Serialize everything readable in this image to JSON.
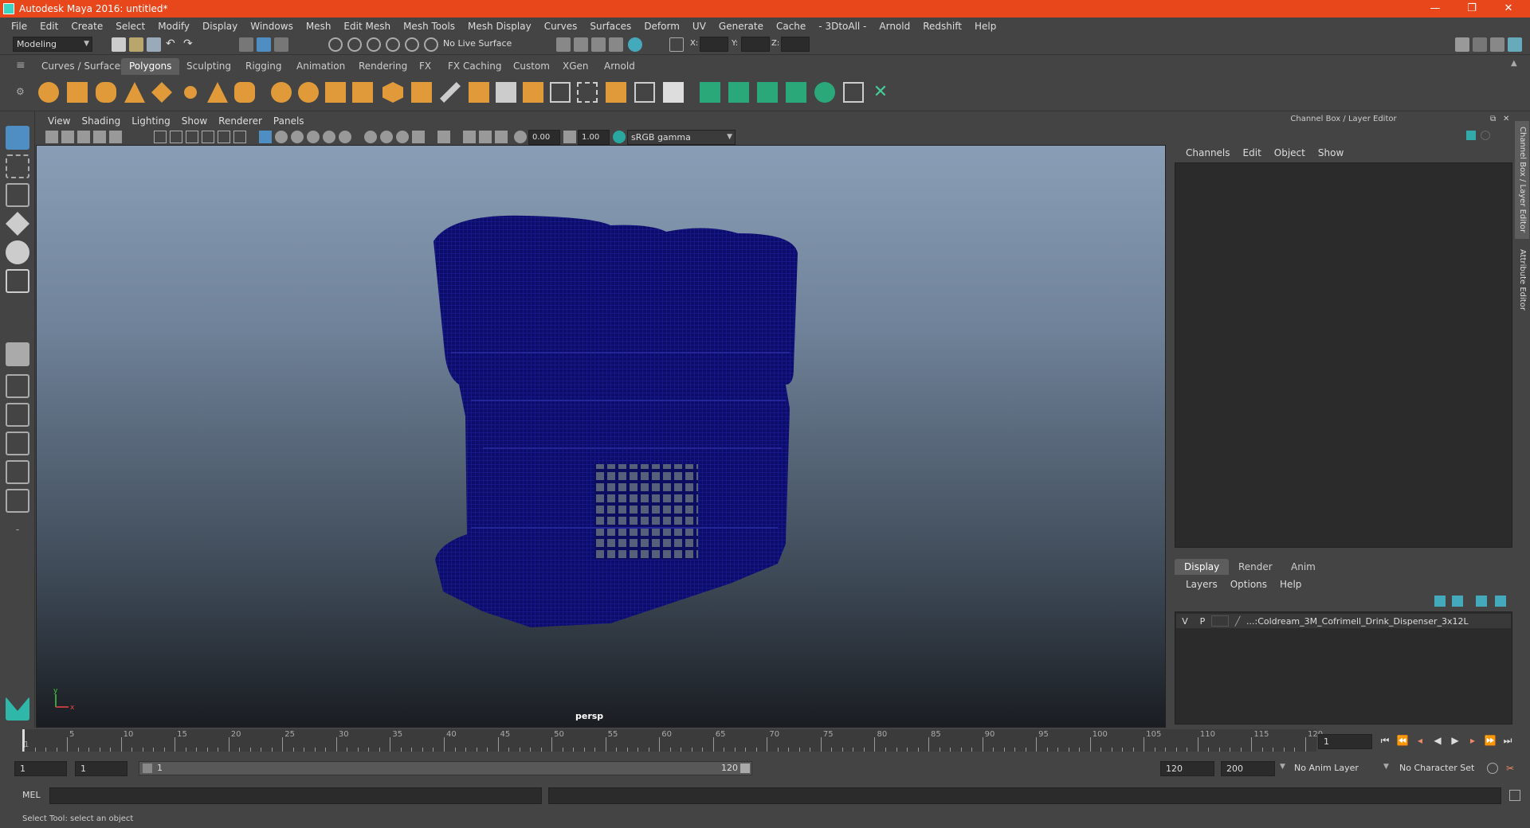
{
  "window": {
    "title": "Autodesk Maya 2016: untitled*",
    "min": "—",
    "max": "❐",
    "close": "✕"
  },
  "menu": [
    "File",
    "Edit",
    "Create",
    "Select",
    "Modify",
    "Display",
    "Windows",
    "Mesh",
    "Edit Mesh",
    "Mesh Tools",
    "Mesh Display",
    "Curves",
    "Surfaces",
    "Deform",
    "UV",
    "Generate",
    "Cache",
    "- 3DtoAll -",
    "Arnold",
    "Redshift",
    "Help"
  ],
  "status": {
    "mode": "Modeling",
    "live_surface": "No Live Surface",
    "x_label": "X:",
    "y_label": "Y:",
    "z_label": "Z:"
  },
  "shelf_tabs": [
    "Curves / Surfaces",
    "Polygons",
    "Sculpting",
    "Rigging",
    "Animation",
    "Rendering",
    "FX",
    "FX Caching",
    "Custom",
    "XGen",
    "Arnold"
  ],
  "shelf_active": "Polygons",
  "viewport": {
    "menu": [
      "View",
      "Shading",
      "Lighting",
      "Show",
      "Renderer",
      "Panels"
    ],
    "exposure": "0.00",
    "gamma": "1.00",
    "colorspace": "sRGB gamma",
    "camera": "persp",
    "axis_y": "y",
    "axis_x": "x"
  },
  "channel_box": {
    "title": "Channel Box / Layer Editor",
    "menu": [
      "Channels",
      "Edit",
      "Object",
      "Show"
    ]
  },
  "layer_editor": {
    "tabs": [
      "Display",
      "Render",
      "Anim"
    ],
    "active": "Display",
    "menu": [
      "Layers",
      "Options",
      "Help"
    ],
    "layer": {
      "v": "V",
      "p": "P",
      "name": "...:Coldream_3M_Cofrimell_Drink_Dispenser_3x12L"
    }
  },
  "side_tabs": [
    "Channel Box / Layer Editor",
    "Attribute Editor"
  ],
  "timeline": {
    "numbers": [
      "5",
      "10",
      "15",
      "20",
      "25",
      "30",
      "35",
      "40",
      "45",
      "50",
      "55",
      "60",
      "65",
      "70",
      "75",
      "80",
      "85",
      "90",
      "95",
      "100",
      "105",
      "110",
      "115",
      "120"
    ],
    "start_label": "1",
    "current_frame": "1"
  },
  "range": {
    "start": "1",
    "inner_start": "1",
    "slider_start": "1",
    "slider_end": "120",
    "end": "120",
    "max": "200",
    "anim_layer": "No Anim Layer",
    "char_set": "No Character Set"
  },
  "cmd": {
    "lang": "MEL"
  },
  "help": "Select Tool: select an object"
}
